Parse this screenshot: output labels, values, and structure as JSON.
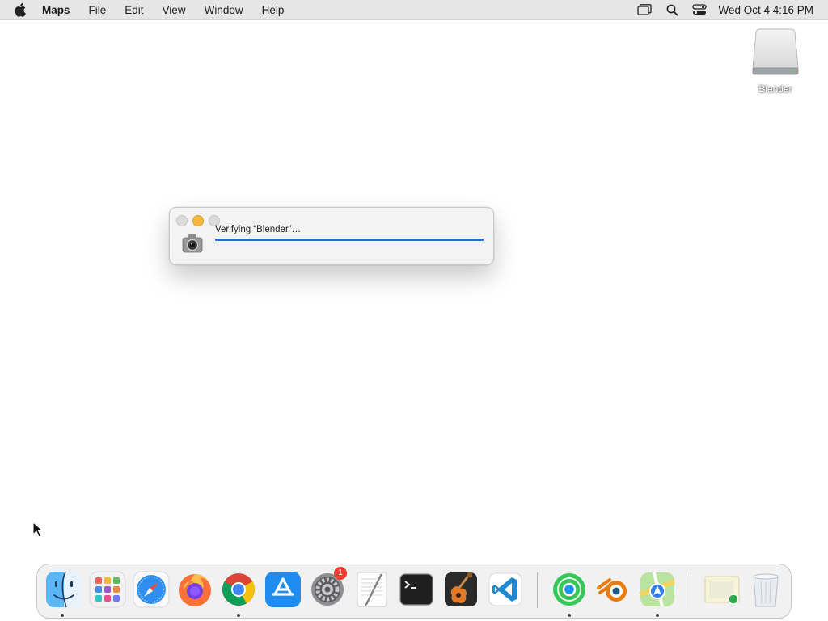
{
  "menubar": {
    "apple_icon": "apple-logo-icon",
    "app_name": "Maps",
    "items": [
      "File",
      "Edit",
      "View",
      "Window",
      "Help"
    ],
    "status_icons": [
      "screen-mirroring-icon",
      "spotlight-search-icon",
      "control-center-icon"
    ],
    "clock": "Wed Oct 4  4:16 PM"
  },
  "desktop": {
    "disk_label": "Blender"
  },
  "dialog": {
    "message": "Verifying “Blender”…",
    "progress": 1.0,
    "icon": "gatekeeper-camera-icon"
  },
  "dock": {
    "apps": [
      "Finder",
      "Launchpad",
      "Safari",
      "Firefox",
      "Google Chrome",
      "App Store",
      "System Settings",
      "TextEdit",
      "Terminal",
      "GarageBand",
      "Visual Studio Code",
      "Find My",
      "Blender",
      "Maps"
    ],
    "settings_badge": "1",
    "stack_items": [
      "Downloads",
      "Trash"
    ]
  },
  "colors": {
    "accent": "#1f6fd1",
    "menubar": "#e6e6e6",
    "badge": "#f23a2f"
  }
}
